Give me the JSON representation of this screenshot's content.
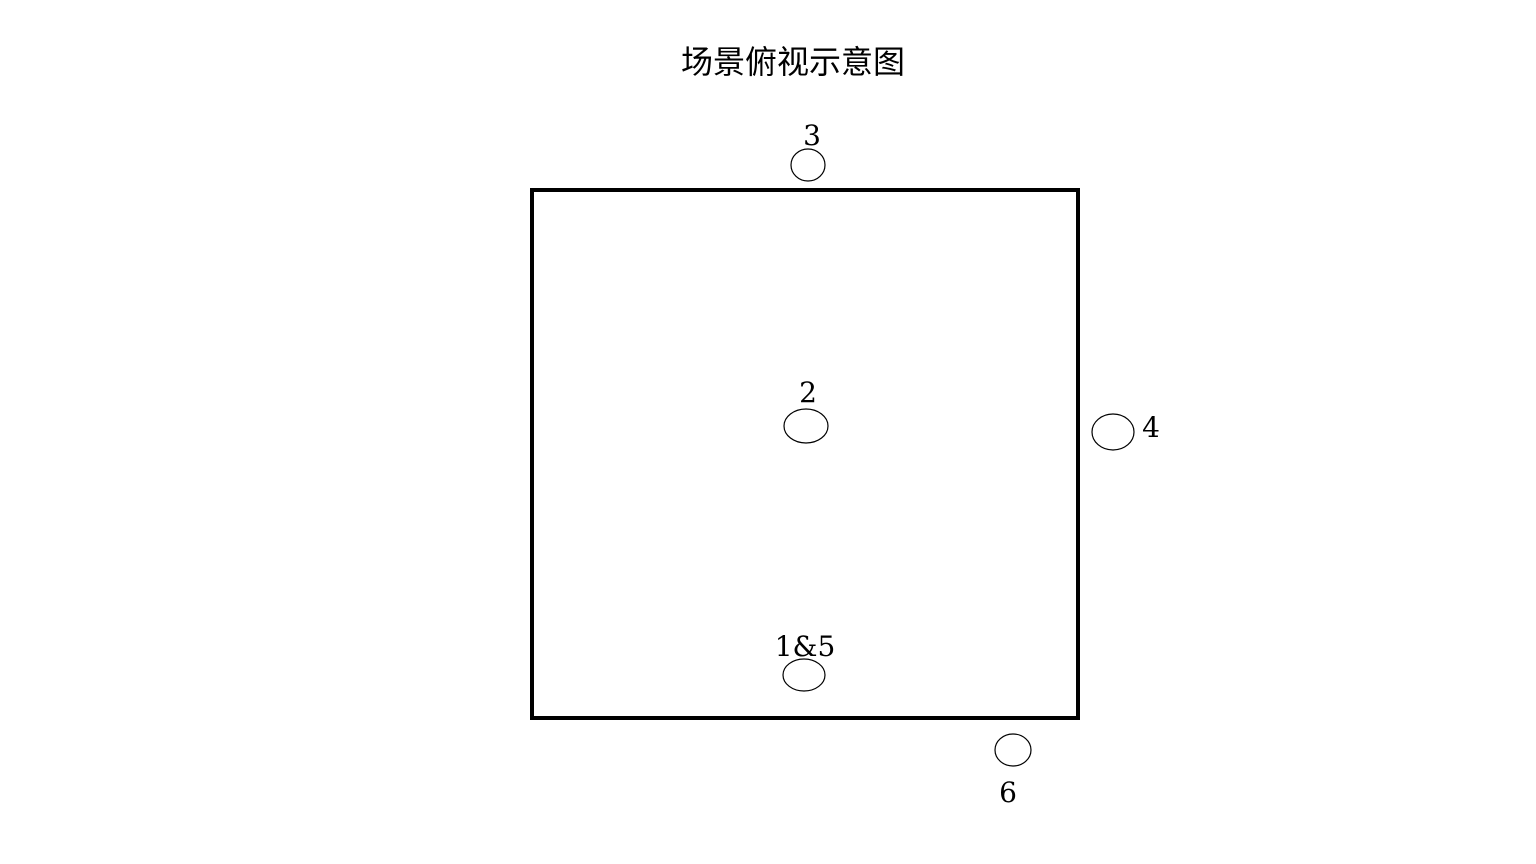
{
  "title": "场景俯视示意图",
  "markers": {
    "m3": {
      "label": "3"
    },
    "m2": {
      "label": "2"
    },
    "m4": {
      "label": "4"
    },
    "m15": {
      "label": "1&5"
    },
    "m6": {
      "label": "6"
    }
  }
}
